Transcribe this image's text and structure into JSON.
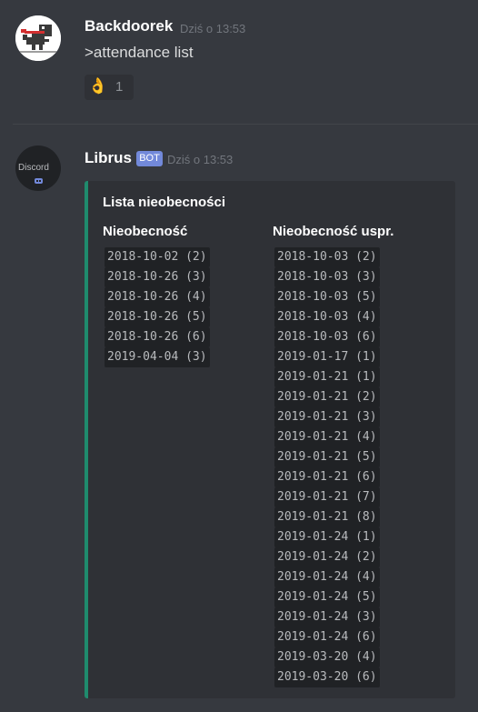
{
  "messages": [
    {
      "author": "Backdoorek",
      "timestamp": "Dziś o 13:53",
      "content": ">attendance list",
      "reaction": {
        "emoji": "👌",
        "count": "1"
      }
    },
    {
      "author": "Librus",
      "badge": "BOT",
      "timestamp": "Dziś o 13:53",
      "avatar_text": "Discord",
      "embed": {
        "title": "Lista nieobecności",
        "accent_color": "#1f8b6d",
        "fields": [
          {
            "name": "Nieobecność",
            "values": [
              "2018-10-02 (2)",
              "2018-10-26 (3)",
              "2018-10-26 (4)",
              "2018-10-26 (5)",
              "2018-10-26 (6)",
              "2019-04-04 (3)"
            ]
          },
          {
            "name": "Nieobecność uspr.",
            "values": [
              "2018-10-03 (2)",
              "2018-10-03 (3)",
              "2018-10-03 (5)",
              "2018-10-03 (4)",
              "2018-10-03 (6)",
              "2019-01-17 (1)",
              "2019-01-21 (1)",
              "2019-01-21 (2)",
              "2019-01-21 (3)",
              "2019-01-21 (4)",
              "2019-01-21 (5)",
              "2019-01-21 (6)",
              "2019-01-21 (7)",
              "2019-01-21 (8)",
              "2019-01-24 (1)",
              "2019-01-24 (2)",
              "2019-01-24 (4)",
              "2019-01-24 (5)",
              "2019-01-24 (3)",
              "2019-01-24 (6)",
              "2019-03-20 (4)",
              "2019-03-20 (6)"
            ]
          }
        ]
      }
    }
  ]
}
